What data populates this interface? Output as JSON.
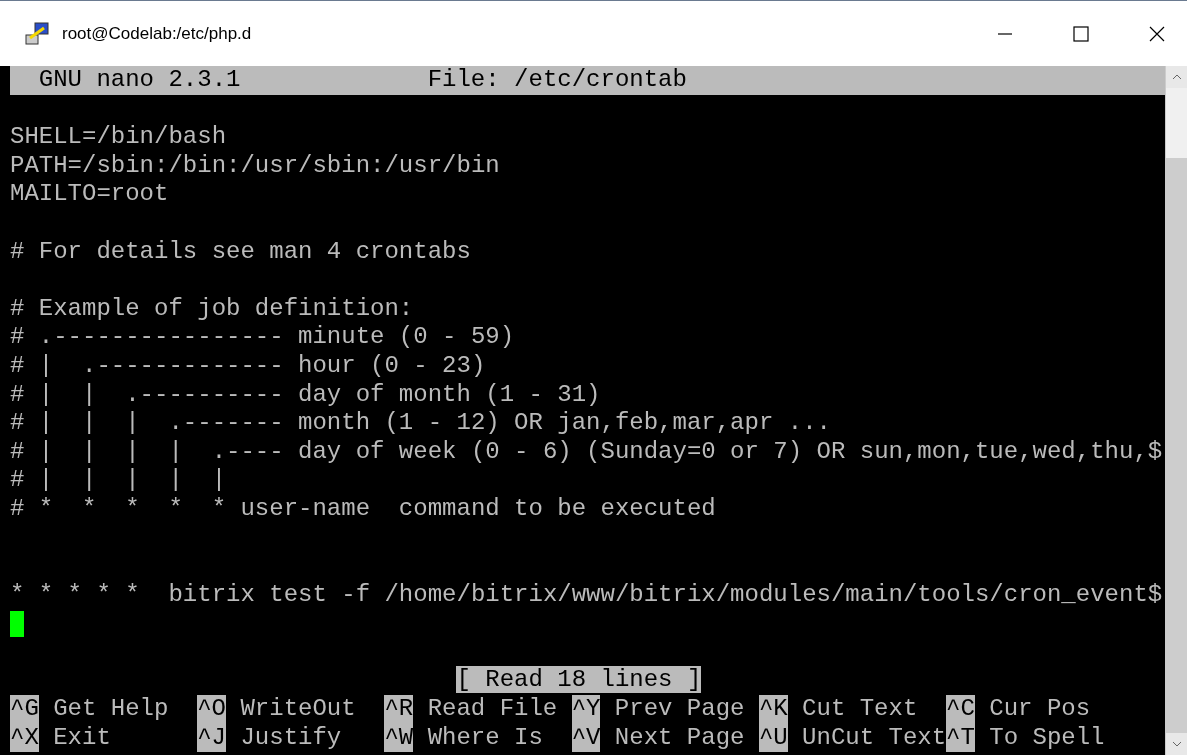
{
  "window": {
    "title": "root@Codelab:/etc/php.d"
  },
  "header": {
    "version": "GNU nano 2.3.1",
    "file": "File: /etc/crontab"
  },
  "lines": [
    {
      "kind": "blank"
    },
    {
      "kind": "text",
      "text": "SHELL=/bin/bash"
    },
    {
      "kind": "text",
      "text": "PATH=/sbin:/bin:/usr/sbin:/usr/bin"
    },
    {
      "kind": "text",
      "text": "MAILTO=root"
    },
    {
      "kind": "blank"
    },
    {
      "kind": "text",
      "text": "# For details see man 4 crontabs"
    },
    {
      "kind": "blank"
    },
    {
      "kind": "text",
      "text": "# Example of job definition:"
    },
    {
      "kind": "text",
      "text": "# .---------------- minute (0 - 59)"
    },
    {
      "kind": "text",
      "text": "# |  .------------- hour (0 - 23)"
    },
    {
      "kind": "text",
      "text": "# |  |  .---------- day of month (1 - 31)"
    },
    {
      "kind": "text",
      "text": "# |  |  |  .------- month (1 - 12) OR jan,feb,mar,apr ..."
    },
    {
      "kind": "text",
      "text": "# |  |  |  |  .---- day of week (0 - 6) (Sunday=0 or 7) OR sun,mon,tue,wed,thu,$"
    },
    {
      "kind": "text",
      "text": "# |  |  |  |  |"
    },
    {
      "kind": "text",
      "text": "# *  *  *  *  * user-name  command to be executed"
    },
    {
      "kind": "blank"
    },
    {
      "kind": "blank"
    },
    {
      "kind": "text",
      "text": "* * * * *  bitrix test -f /home/bitrix/www/bitrix/modules/main/tools/cron_event$"
    },
    {
      "kind": "cursor"
    },
    {
      "kind": "blank"
    }
  ],
  "status": "[ Read 18 lines ]",
  "shortcuts": [
    [
      {
        "key": "^G",
        "label": "Get Help"
      },
      {
        "key": "^O",
        "label": "WriteOut"
      },
      {
        "key": "^R",
        "label": "Read File"
      },
      {
        "key": "^Y",
        "label": "Prev Page"
      },
      {
        "key": "^K",
        "label": "Cut Text"
      },
      {
        "key": "^C",
        "label": "Cur Pos"
      }
    ],
    [
      {
        "key": "^X",
        "label": "Exit"
      },
      {
        "key": "^J",
        "label": "Justify"
      },
      {
        "key": "^W",
        "label": "Where Is"
      },
      {
        "key": "^V",
        "label": "Next Page"
      },
      {
        "key": "^U",
        "label": "UnCut Text"
      },
      {
        "key": "^T",
        "label": "To Spell"
      }
    ]
  ]
}
